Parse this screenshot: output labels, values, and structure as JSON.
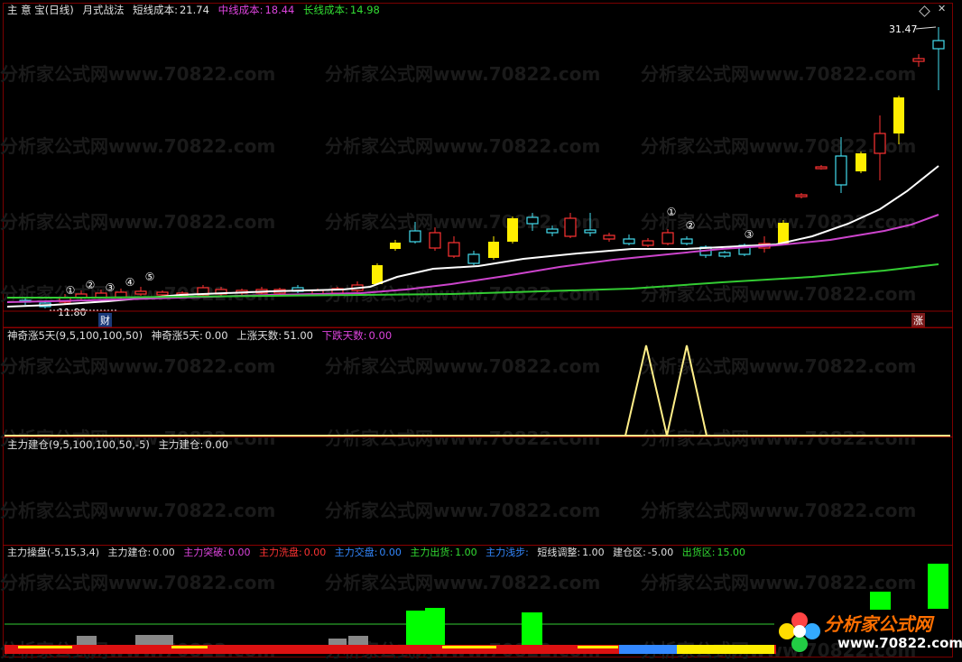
{
  "panel1": {
    "title": "主 意 宝(日线)",
    "indicator": "月式战法",
    "short_cost_label": "短线成本:",
    "short_cost_value": "21.74",
    "mid_cost_label": "中线成本:",
    "mid_cost_value": "18.44",
    "long_cost_label": "长线成本:",
    "long_cost_value": "14.98",
    "high_price": "31.47",
    "low_price": "11.80",
    "cai_tag": "财",
    "zhang_tag": "涨",
    "markers": [
      "①",
      "②",
      "③",
      "④",
      "⑤",
      "①",
      "②",
      "③"
    ]
  },
  "panel2": {
    "indicator": "神奇涨5天(9,5,100,100,50)",
    "value_label": "神奇涨5天:",
    "value": "0.00",
    "up_days_label": "上涨天数:",
    "up_days": "51.00",
    "down_days_label": "下跌天数:",
    "down_days": "0.00"
  },
  "panel3": {
    "indicator": "主力建仓(9,5,100,100,50,-5)",
    "value_label": "主力建仓:",
    "value": "0.00"
  },
  "panel4": {
    "indicator": "主力操盘(-5,15,3,4)",
    "jiancang_label": "主力建仓:",
    "jiancang_value": "0.00",
    "tupo_label": "主力突破:",
    "tupo_value": "0.00",
    "xipan_label": "主力洗盘:",
    "xipan_value": "0.00",
    "jiaopan_label": "主力交盘:",
    "jiaopan_value": "0.00",
    "chuhuo_label": "主力出货:",
    "chuhuo_value": "1.00",
    "xianbu_label": "主力浅步:",
    "tiaozheng_label": "短线调整:",
    "tiaozheng_value": "1.00",
    "jiancangqu_label": "建仓区:",
    "jiancangqu_value": "-5.00",
    "chuhuoqu_label": "出货区:",
    "chuhuoqu_value": "15.00"
  },
  "watermark": "分析家公式网www.70822.com",
  "logo": {
    "name": "分析家公式网",
    "url": "www.70822.com"
  },
  "colors": {
    "background": "#000000",
    "up_candle": "#ff3333",
    "down_candle": "#44ddee",
    "yellow_candle": "#ffee00",
    "short_line": "#ffffff",
    "mid_line": "#cc44cc",
    "long_line": "#33cc33",
    "label_magenta": "#dd44dd",
    "label_green": "#33dd33",
    "label_red": "#ff3333",
    "label_blue": "#3388ff",
    "bar_green": "#00ff00",
    "bar_gray": "#888888"
  }
}
